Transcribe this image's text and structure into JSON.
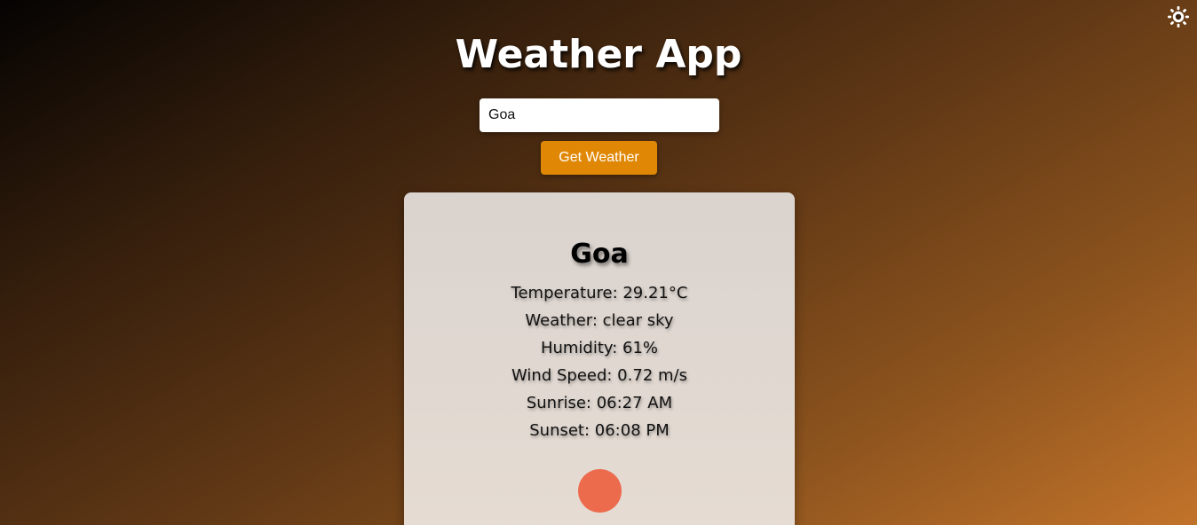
{
  "header": {
    "title": "Weather App"
  },
  "theme_toggle": {
    "icon": "sun-icon"
  },
  "search": {
    "value": "Goa",
    "placeholder": "",
    "button_label": "Get Weather"
  },
  "weather": {
    "city": "Goa",
    "temperature": "Temperature: 29.21°C",
    "condition": "Weather: clear sky",
    "humidity": "Humidity: 61%",
    "wind_speed": "Wind Speed: 0.72 m/s",
    "sunrise": "Sunrise: 06:27 AM",
    "sunset": "Sunset: 06:08 PM",
    "icon": "sun-circle-icon"
  },
  "colors": {
    "accent_button": "#e08806",
    "sun_icon": "#ed6b4d"
  }
}
